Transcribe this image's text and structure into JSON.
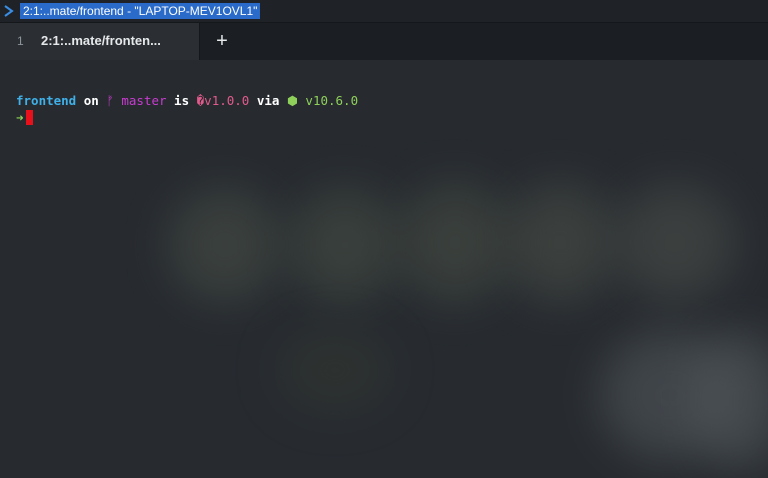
{
  "titlebar": {
    "icon": "terminal-prompt-icon",
    "title": "2:1:..mate/frontend - \"LAPTOP-MEV1OVL1\""
  },
  "tabs": [
    {
      "number": "1",
      "label": "2:1:..mate/fronten..."
    }
  ],
  "new_tab_label": "+",
  "prompt": {
    "directory": "frontend",
    "on": " on ",
    "branch_icon": "ᚠ",
    "branch": " master",
    "is": " is ",
    "package_icon": "�",
    "package_version": "v1.0.0",
    "via": " via ",
    "node_icon": "⬢",
    "node_version": " v10.6.0",
    "arrow": "➜"
  },
  "colors": {
    "directory": "#3fb0e8",
    "branch": "#c83cd0",
    "package": "#e25a8c",
    "node": "#8fd05a",
    "cursor": "#e8101a",
    "title_highlight": "#2a6bc9"
  }
}
